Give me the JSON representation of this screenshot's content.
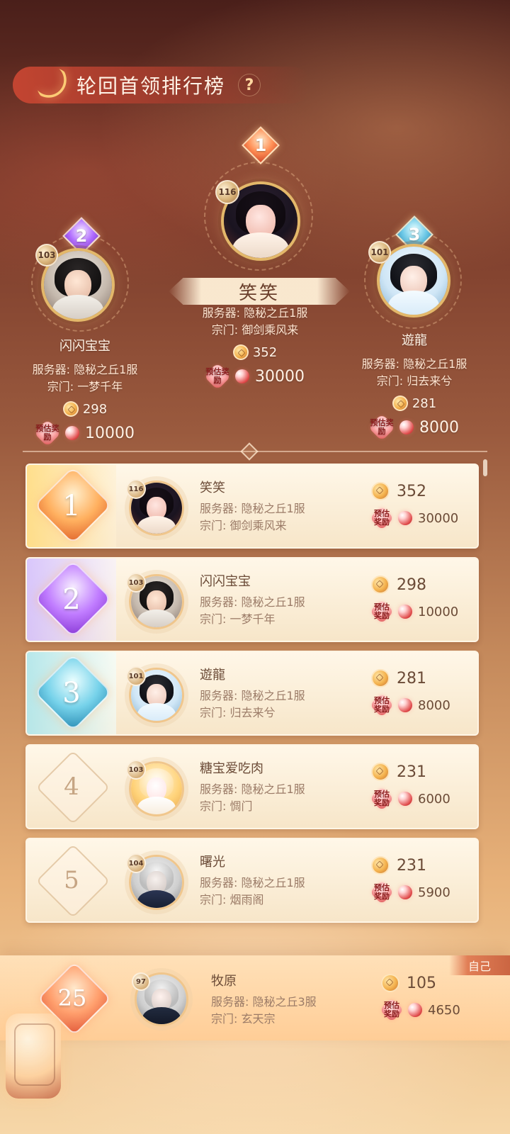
{
  "header": {
    "title": "轮回首领排行榜",
    "help_symbol": "?"
  },
  "podium": {
    "first": {
      "rank": "1",
      "level": "116",
      "name": "笑笑",
      "server_line": "服务器: 隐秘之丘1服",
      "sect_line": "宗门: 御剑乘风来",
      "score": "352",
      "reward": "30000",
      "badge_text": "预估奖励"
    },
    "second": {
      "rank": "2",
      "level": "103",
      "name": "闪闪宝宝",
      "server_line": "服务器: 隐秘之丘1服",
      "sect_line": "宗门: 一梦千年",
      "score": "298",
      "reward": "10000",
      "badge_text": "预估奖励"
    },
    "third": {
      "rank": "3",
      "level": "101",
      "name": "遊龍",
      "server_line": "服务器: 隐秘之丘1服",
      "sect_line": "宗门: 归去来兮",
      "score": "281",
      "reward": "8000",
      "badge_text": "预估奖励"
    }
  },
  "list": [
    {
      "rank": "1",
      "level": "116",
      "name": "笑笑",
      "server": "服务器: 隐秘之丘1服",
      "sect": "宗门: 御剑乘风来",
      "score": "352",
      "reward": "30000",
      "badge_text": "预估奖励"
    },
    {
      "rank": "2",
      "level": "103",
      "name": "闪闪宝宝",
      "server": "服务器: 隐秘之丘1服",
      "sect": "宗门: 一梦千年",
      "score": "298",
      "reward": "10000",
      "badge_text": "预估奖励"
    },
    {
      "rank": "3",
      "level": "101",
      "name": "遊龍",
      "server": "服务器: 隐秘之丘1服",
      "sect": "宗门: 归去来兮",
      "score": "281",
      "reward": "8000",
      "badge_text": "预估奖励"
    },
    {
      "rank": "4",
      "level": "103",
      "name": "糖宝爱吃肉",
      "server": "服务器: 隐秘之丘1服",
      "sect": "宗门: 惆门",
      "score": "231",
      "reward": "6000",
      "badge_text": "预估奖励"
    },
    {
      "rank": "5",
      "level": "104",
      "name": "曙光",
      "server": "服务器: 隐秘之丘1服",
      "sect": "宗门: 烟雨阁",
      "score": "231",
      "reward": "5900",
      "badge_text": "预估奖励"
    }
  ],
  "self": {
    "tag": "自己",
    "rank": "25",
    "level": "97",
    "name": "牧原",
    "server": "服务器: 隐秘之丘3服",
    "sect": "宗门: 玄天宗",
    "score": "105",
    "reward": "4650",
    "badge_text": "预估奖励"
  }
}
